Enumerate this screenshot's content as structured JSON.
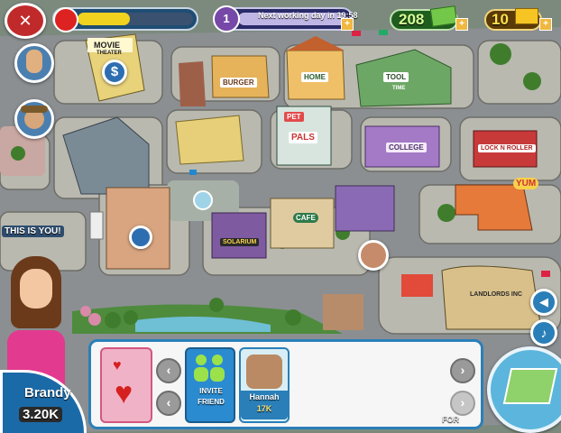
{
  "hud": {
    "day_progress_value": "1",
    "day_progress_text": "Next working day in 19:58",
    "plus_label": "+",
    "cash_amount": "208",
    "gold_amount": "10",
    "energy_fraction": 0.45
  },
  "map_labels": {
    "movie_theater": "MOVIE",
    "movie_sub": "THEATER",
    "burger": "BURGER",
    "home": "HOME",
    "tool_time": "TOOL",
    "tool_sub": "TIME",
    "pet_pals": "PET",
    "pet_sub": "PALS",
    "college": "COLLEGE",
    "lock_roller": "LOCK N ROLLER",
    "yum": "YUM",
    "cafe": "CAFE",
    "solarium": "SOLARIUM",
    "landlords_inc": "LANDLORDS INC",
    "this_is_you": "THIS IS YOU!"
  },
  "player": {
    "name": "Brandy",
    "money": "3.20K"
  },
  "friends": {
    "invite_label_1": "INVITE",
    "invite_label_2": "FRIEND",
    "friend_name": "Hannah",
    "friend_money": "17K"
  },
  "watermark": "FOR"
}
